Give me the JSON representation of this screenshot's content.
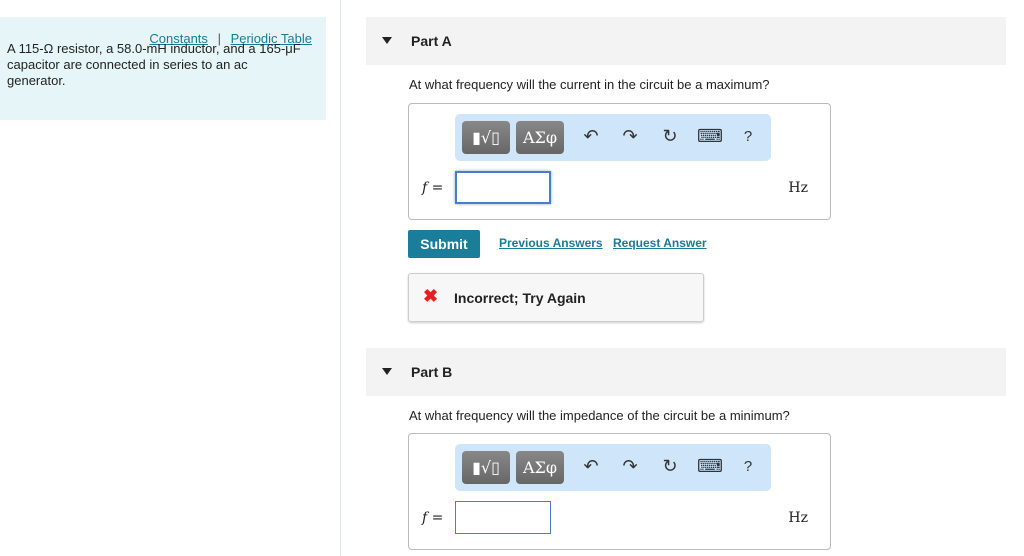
{
  "sidebar": {
    "constants": "Constants",
    "separator": "|",
    "periodic_table": "Periodic Table",
    "problem": "A 115-Ω resistor, a 58.0-mH inductor, and a 165-μF capacitor are connected in series to an ac generator."
  },
  "partA": {
    "label": "Part A",
    "question": "At what frequency will the current in the circuit be a maximum?",
    "var": "f =",
    "value": "",
    "unit": "Hz",
    "submit": "Submit",
    "previous": "Previous Answers",
    "request": "Request Answer",
    "feedback": "Incorrect; Try Again"
  },
  "partB": {
    "label": "Part B",
    "question": "At what frequency will the impedance of the circuit be a minimum?",
    "var": "f =",
    "value": "",
    "unit": "Hz"
  },
  "toolbar": {
    "templates": "▮√▯",
    "greek": "ΑΣφ",
    "undo": "↶",
    "redo": "↷",
    "reset": "↻",
    "keyboard": "⌨",
    "help": "?"
  }
}
